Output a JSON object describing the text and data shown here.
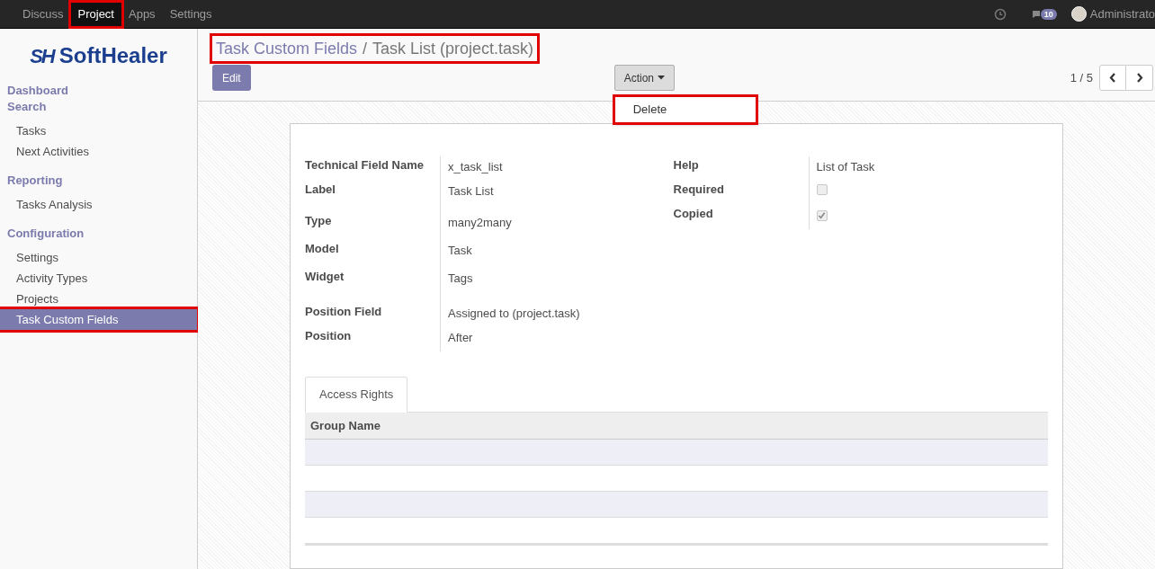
{
  "top_menu": [
    {
      "label": "Discuss",
      "selected": false,
      "highlighted": false
    },
    {
      "label": "Project",
      "selected": true,
      "highlighted": true
    },
    {
      "label": "Apps",
      "selected": false,
      "highlighted": false
    },
    {
      "label": "Settings",
      "selected": false,
      "highlighted": false
    }
  ],
  "systray": {
    "message_count": "10",
    "user": "Administrato"
  },
  "logo": {
    "mark": "SH",
    "name": "SoftHealer"
  },
  "sidebar": [
    {
      "kind": "heading",
      "label": "Dashboard",
      "selected": false,
      "highlighted": false
    },
    {
      "kind": "heading",
      "label": "Search",
      "selected": false,
      "highlighted": false
    },
    {
      "kind": "item",
      "label": "Tasks",
      "selected": false,
      "highlighted": false
    },
    {
      "kind": "item",
      "label": "Next Activities",
      "selected": false,
      "highlighted": false
    },
    {
      "kind": "heading",
      "label": "Reporting",
      "selected": false,
      "highlighted": false
    },
    {
      "kind": "item",
      "label": "Tasks Analysis",
      "selected": false,
      "highlighted": false
    },
    {
      "kind": "heading",
      "label": "Configuration",
      "selected": false,
      "highlighted": false
    },
    {
      "kind": "item",
      "label": "Settings",
      "selected": false,
      "highlighted": false
    },
    {
      "kind": "item",
      "label": "Activity Types",
      "selected": false,
      "highlighted": false
    },
    {
      "kind": "item",
      "label": "Projects",
      "selected": false,
      "highlighted": false
    },
    {
      "kind": "item",
      "label": "Task Custom Fields",
      "selected": true,
      "highlighted": true
    }
  ],
  "breadcrumb": {
    "parent": "Task Custom Fields",
    "separator": "/",
    "current": "Task List (project.task)",
    "highlighted": true
  },
  "buttons": {
    "edit": "Edit",
    "action": "Action"
  },
  "action_menu": [
    {
      "label": "Delete",
      "highlighted": true
    }
  ],
  "pager": "1 / 5",
  "left_fields": [
    {
      "label": "Technical Field Name",
      "value": "x_task_list"
    },
    {
      "label": "Label",
      "value": "Task List"
    },
    {
      "label": "Type",
      "value": "many2many"
    },
    {
      "label": "Model",
      "value": "Task"
    },
    {
      "label": "Widget",
      "value": "Tags"
    },
    {
      "label": "Position Field",
      "value": "Assigned to (project.task)"
    },
    {
      "label": "Position",
      "value": "After"
    }
  ],
  "right_fields": [
    {
      "kind": "text",
      "label": "Help",
      "value": "List of Task"
    },
    {
      "kind": "checkbox",
      "label": "Required",
      "checked": false
    },
    {
      "kind": "checkbox",
      "label": "Copied",
      "checked": true
    }
  ],
  "tabs": [
    {
      "label": "Access Rights",
      "selected": true
    }
  ],
  "table": {
    "columns": [
      "Group Name"
    ]
  }
}
